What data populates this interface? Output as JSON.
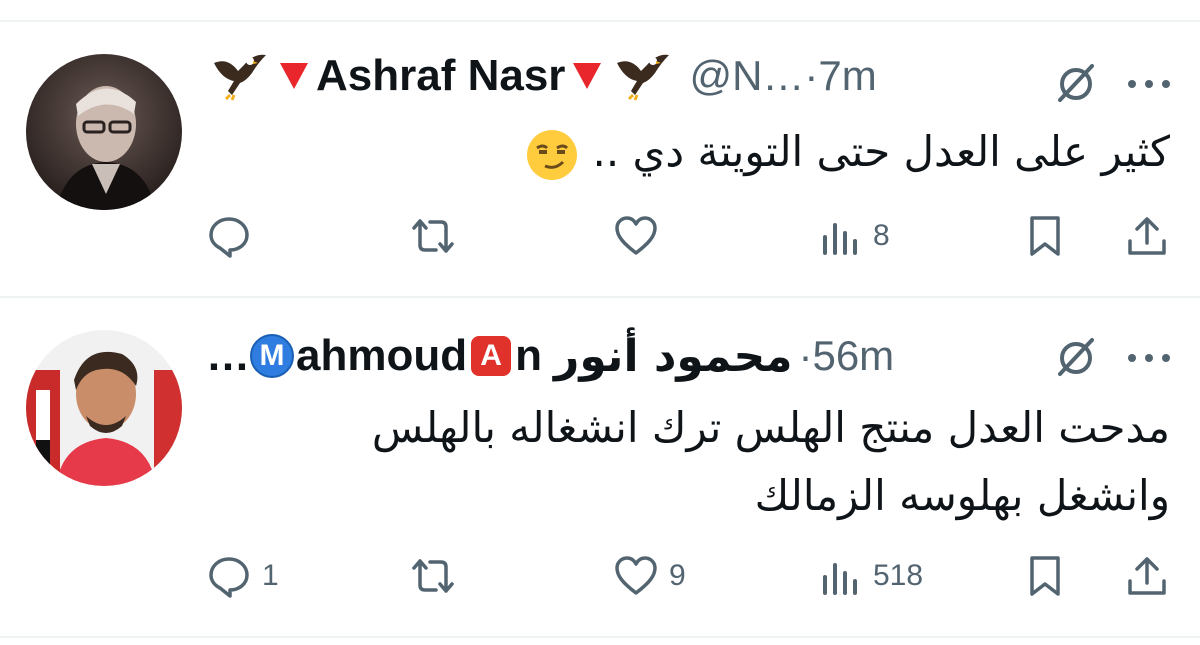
{
  "tweets": [
    {
      "author": {
        "emoji_prefix": "🦅🔻",
        "name": "Ashraf Nasr",
        "emoji_suffix": "🔻🦅"
      },
      "handle_time": "@N…·7m",
      "text": "كثير على العدل حتى التويتة دي ..",
      "text_emoji": "😏",
      "actions": {
        "reply": "",
        "retweet": "",
        "like": "",
        "views": "8"
      },
      "icons": [
        "reply-icon",
        "retweet-icon",
        "like-icon",
        "views-icon",
        "bookmark-icon",
        "share-icon",
        "grok-icon",
        "more-icon"
      ]
    },
    {
      "author": {
        "name_ar": "محمود أنور",
        "badge_a": "A",
        "name_mid": "n",
        "name_en": "ahmoud",
        "badge_m": "M",
        "ellipsis": "…"
      },
      "time": "·56m",
      "text_lines": [
        "مدحت العدل منتج الهلس ترك انشغاله بالهلس",
        "وانشغل بهلوسه الزمالك"
      ],
      "actions": {
        "reply": "1",
        "retweet": "",
        "like": "9",
        "views": "518"
      },
      "icons": [
        "reply-icon",
        "retweet-icon",
        "like-icon",
        "views-icon",
        "bookmark-icon",
        "share-icon",
        "grok-icon",
        "more-icon"
      ]
    }
  ]
}
